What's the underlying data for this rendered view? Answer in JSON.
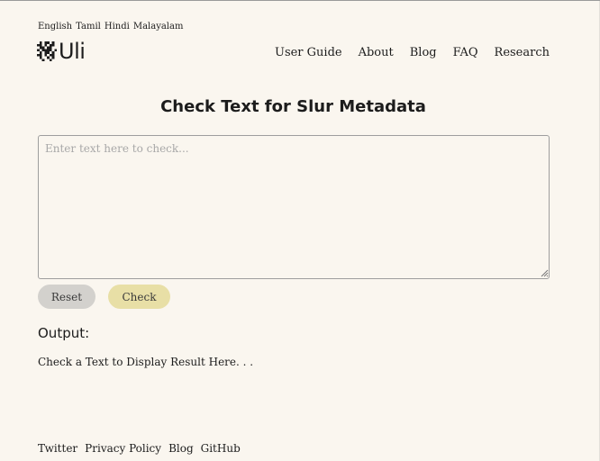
{
  "languages": [
    "English",
    "Tamil",
    "Hindi",
    "Malayalam"
  ],
  "logo": {
    "text": "Uli",
    "icon": "checker-logo-icon"
  },
  "nav": [
    "User Guide",
    "About",
    "Blog",
    "FAQ",
    "Research"
  ],
  "title": "Check Text for Slur Metadata",
  "input": {
    "placeholder": "Enter text here to check...",
    "value": ""
  },
  "buttons": {
    "reset": "Reset",
    "check": "Check"
  },
  "output": {
    "label": "Output:",
    "text": "Check a Text to Display Result Here. . ."
  },
  "footer": [
    "Twitter",
    "Privacy Policy",
    "Blog",
    "GitHub"
  ],
  "colors": {
    "background": "#faf6ef",
    "check_button": "#e8dfa6",
    "reset_button": "#d3d1cd"
  }
}
